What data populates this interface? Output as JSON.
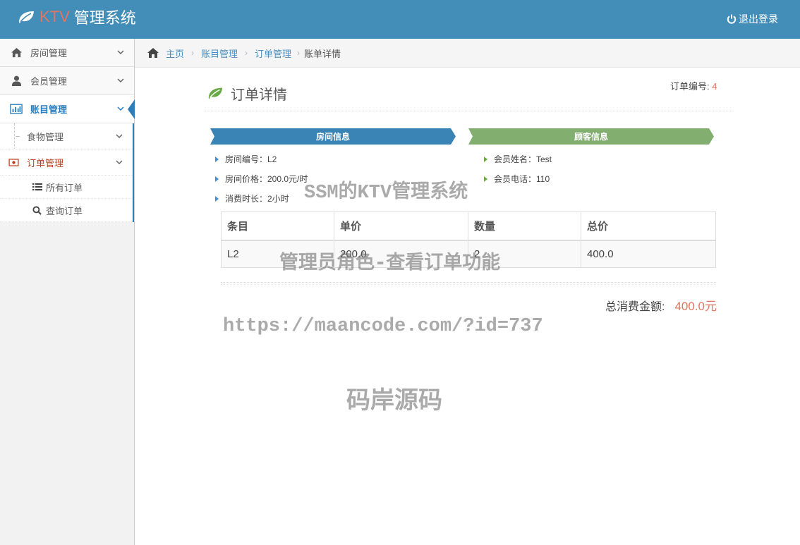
{
  "app": {
    "brand_prefix": "KTV",
    "brand_suffix": "管理系统",
    "logout_label": "退出登录"
  },
  "sidebar": {
    "items": [
      {
        "label": "房间管理",
        "icon": "home-icon"
      },
      {
        "label": "会员管理",
        "icon": "user-icon"
      },
      {
        "label": "账目管理",
        "icon": "bar-chart-icon"
      }
    ],
    "sub_items": [
      {
        "label": "食物管理"
      },
      {
        "label": "订单管理",
        "icon": "money-icon"
      }
    ],
    "sub_sub_items": [
      {
        "label": "所有订单",
        "icon": "list-icon"
      },
      {
        "label": "查询订单",
        "icon": "search-icon"
      }
    ]
  },
  "breadcrumb": {
    "items": [
      "主页",
      "账目管理",
      "订单管理"
    ],
    "current": "账单详情"
  },
  "page": {
    "title": "订单详情",
    "order_no_label": "订单编号:",
    "order_no_value": "4"
  },
  "room_info": {
    "ribbon": "房间信息",
    "lines": [
      "房间编号：L2",
      "房间价格：200.0元/时",
      "消费时长：2小时"
    ]
  },
  "customer_info": {
    "ribbon": "顾客信息",
    "lines": [
      "会员姓名：Test",
      "会员电话：110"
    ]
  },
  "table": {
    "headers": [
      "条目",
      "单价",
      "数量",
      "总价"
    ],
    "rows": [
      [
        "L2",
        "200.0",
        "2",
        "400.0"
      ]
    ]
  },
  "total": {
    "label": "总消费金额:",
    "value": "400.0元"
  },
  "watermarks": [
    "SSM的KTV管理系统",
    "管理员角色-查看订单功能",
    "https://maancode.com/?id=737",
    "码岸源码"
  ],
  "colors": {
    "header": "#438eb9",
    "brand_accent": "#e2755f",
    "room_ribbon": "#3983b5",
    "customer_ribbon": "#82af6f",
    "active_blue": "#2b7dbc"
  }
}
